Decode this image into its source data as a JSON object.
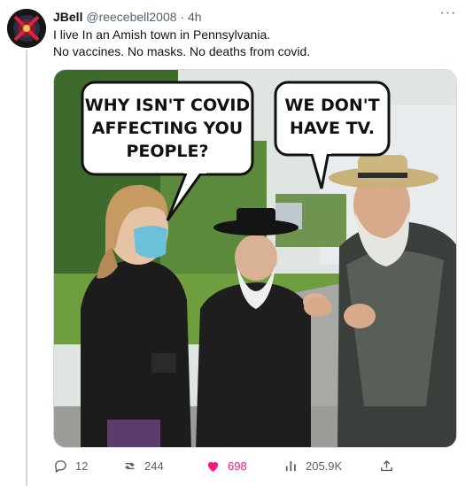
{
  "tweet": {
    "display_name": "JBell",
    "handle": "@reecebell2008",
    "separator": "·",
    "time": "4h",
    "more_label": "···",
    "text_lines": [
      "I live In an Amish town in Pennsylvania.",
      "No vaccines. No masks. No deaths from covid."
    ],
    "media": {
      "bubble_left_lines": [
        "WHY ISN'T COVID",
        "AFFECTING YOU",
        "PEOPLE?"
      ],
      "bubble_right_lines": [
        "WE DON'T",
        "HAVE TV."
      ]
    },
    "actions": {
      "replies": "12",
      "retweets": "244",
      "likes": "698",
      "views": "205.9K"
    },
    "colors": {
      "like_active": "#f91880",
      "muted": "#536471",
      "thread_line": "#cfd9de"
    },
    "icons": [
      "reply-icon",
      "retweet-icon",
      "heart-icon",
      "views-icon",
      "share-icon",
      "more-icon"
    ]
  }
}
